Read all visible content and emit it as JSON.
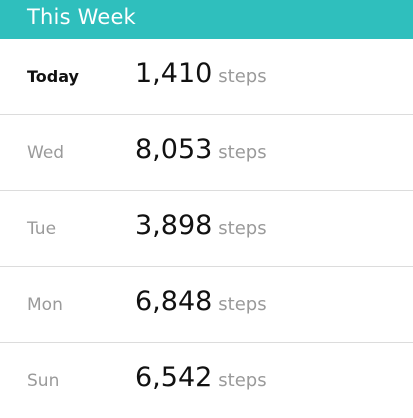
{
  "header": {
    "title": "This Week"
  },
  "rows": [
    {
      "day": "Today",
      "value": "1,410",
      "unit": "steps"
    },
    {
      "day": "Wed",
      "value": "8,053",
      "unit": "steps"
    },
    {
      "day": "Tue",
      "value": "3,898",
      "unit": "steps"
    },
    {
      "day": "Mon",
      "value": "6,848",
      "unit": "steps"
    },
    {
      "day": "Sun",
      "value": "6,542",
      "unit": "steps"
    }
  ],
  "colors": {
    "header_bg": "#2fbfbd",
    "muted_text": "#9a9a9a"
  }
}
